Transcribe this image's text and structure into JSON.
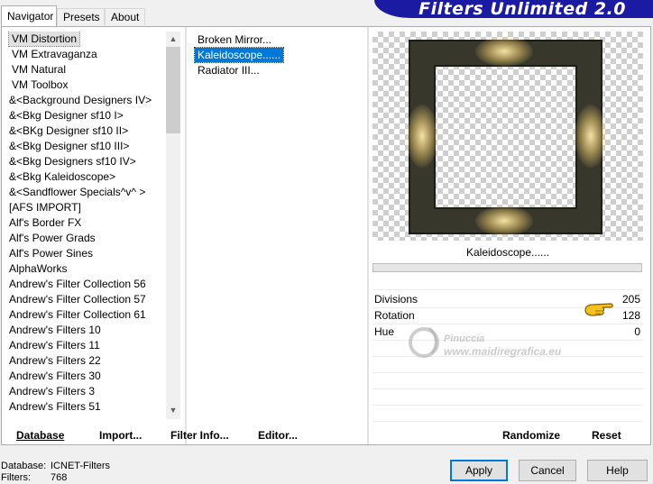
{
  "tabs": [
    {
      "label": "Navigator",
      "active": true
    },
    {
      "label": "Presets",
      "active": false
    },
    {
      "label": "About",
      "active": false
    }
  ],
  "banner_title": "Filters Unlimited 2.0",
  "categories": [
    "VM Distortion",
    "VM Extravaganza",
    "VM Natural",
    "VM Toolbox",
    "&<Background Designers IV>",
    "&<Bkg Designer sf10 I>",
    "&<BKg Designer sf10 II>",
    "&<Bkg Designer sf10 III>",
    "&<Bkg Designers sf10 IV>",
    "&<Bkg Kaleidoscope>",
    "&<Sandflower Specials^v^ >",
    "[AFS IMPORT]",
    "Alf's Border FX",
    "Alf's Power Grads",
    "Alf's Power Sines",
    "AlphaWorks",
    "Andrew's Filter Collection 56",
    "Andrew's Filter Collection 57",
    "Andrew's Filter Collection 61",
    "Andrew's Filters 10",
    "Andrew's Filters 11",
    "Andrew's Filters 22",
    "Andrew's Filters 30",
    "Andrew's Filters 3",
    "Andrew's Filters 51"
  ],
  "selected_category": "VM Distortion",
  "filters": [
    "Broken Mirror...",
    "Kaleidoscope......",
    "Radiator III..."
  ],
  "selected_filter": "Kaleidoscope......",
  "preview_filter_name": "Kaleidoscope......",
  "params": [
    {
      "label": "Divisions",
      "value": "205"
    },
    {
      "label": "Rotation",
      "value": "128"
    },
    {
      "label": "Hue",
      "value": "0"
    }
  ],
  "watermark": {
    "line1": "Pinuccia",
    "line2": "www.maidiregrafica.eu"
  },
  "bottom_buttons": {
    "database": "Database",
    "import": "Import...",
    "filter_info": "Filter Info...",
    "editor": "Editor...",
    "randomize": "Randomize",
    "reset": "Reset"
  },
  "footer": {
    "database_label": "Database:",
    "database_value": "ICNET-Filters",
    "filters_label": "Filters:",
    "filters_value": "768"
  },
  "dialog_buttons": {
    "apply": "Apply",
    "cancel": "Cancel",
    "help": "Help"
  },
  "colors": {
    "banner": "#1a1aa3",
    "selection": "#0078d7",
    "frame": "#37372b",
    "glow": "#f0d88a"
  }
}
